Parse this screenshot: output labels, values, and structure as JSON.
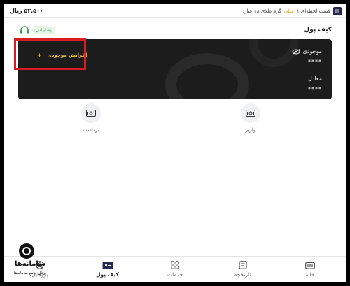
{
  "top_bar": {
    "price_text_before": "قیمت لحظه‌ای ۱",
    "price_text_highlight": "میلی",
    "price_text_after": "گرم طلای ۱۸ عیار:",
    "price_value": "۵۳,۵۰۰ ریال"
  },
  "header": {
    "title": "کیف پول",
    "support_label": "پشتیبانی"
  },
  "wallet_card": {
    "balance_label": "موجودی",
    "balance_value": "****",
    "equivalent_label": "معادل",
    "equivalent_value": "****",
    "increase_label": "افزایش موجودی",
    "increase_icon": "+"
  },
  "actions": {
    "deposit_label": "واریز",
    "withdraw_label": "برداشت"
  },
  "bottom_nav": {
    "items": [
      {
        "label": "خانه",
        "icon": "home-icon"
      },
      {
        "label": "تاریخچه",
        "icon": "history-icon"
      },
      {
        "label": "خدمات",
        "icon": "services-icon"
      },
      {
        "label": "کیف پول",
        "icon": "wallet-icon"
      },
      {
        "label": "پروفایل",
        "icon": "profile-icon"
      }
    ],
    "active_index": 3
  },
  "watermark": {
    "name": "سامانه‌ها",
    "subtitle": "پرتال جامع سامانه‌ها"
  },
  "colors": {
    "card_bg": "#1c1c1c",
    "accent_gold": "#f0c040",
    "highlight_red": "#d91c24",
    "support_green": "#2a9d45"
  }
}
